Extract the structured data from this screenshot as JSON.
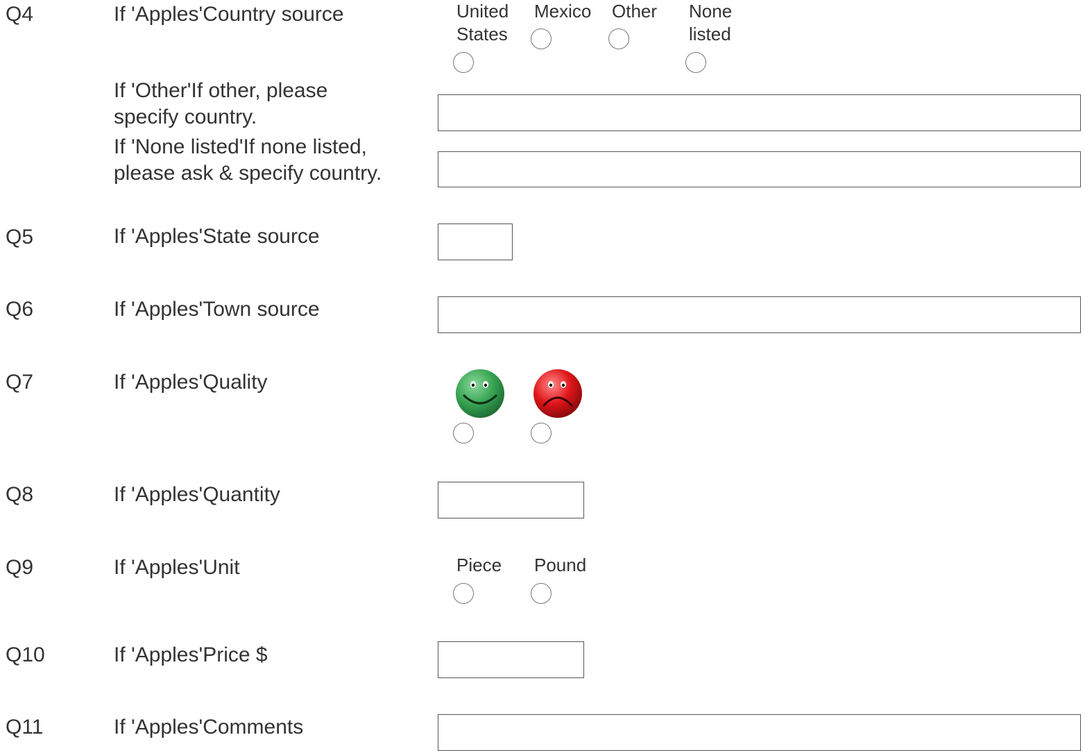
{
  "questions": {
    "q4": {
      "number": "Q4",
      "label": "If 'Apples'Country source",
      "options": [
        "United States",
        "Mexico",
        "Other",
        "None listed"
      ],
      "other": {
        "label_line1": "If 'Other'If other, please",
        "label_line2": "specify country.",
        "value": ""
      },
      "none": {
        "label_line1": "If 'None listed'If none listed,",
        "label_line2": "please ask & specify country.",
        "value": ""
      }
    },
    "q5": {
      "number": "Q5",
      "label": "If 'Apples'State source",
      "value": ""
    },
    "q6": {
      "number": "Q6",
      "label": "If 'Apples'Town source",
      "value": ""
    },
    "q7": {
      "number": "Q7",
      "label": "If 'Apples'Quality",
      "options": [
        "smiley-green-icon",
        "frown-red-icon"
      ],
      "colors": {
        "good": "#3aa655",
        "bad": "#e0161a"
      }
    },
    "q8": {
      "number": "Q8",
      "label": "If 'Apples'Quantity",
      "value": ""
    },
    "q9": {
      "number": "Q9",
      "label": "If 'Apples'Unit",
      "options": [
        "Piece",
        "Pound"
      ]
    },
    "q10": {
      "number": "Q10",
      "label": "If 'Apples'Price $",
      "value": ""
    },
    "q11": {
      "number": "Q11",
      "label": "If 'Apples'Comments",
      "value": ""
    }
  }
}
